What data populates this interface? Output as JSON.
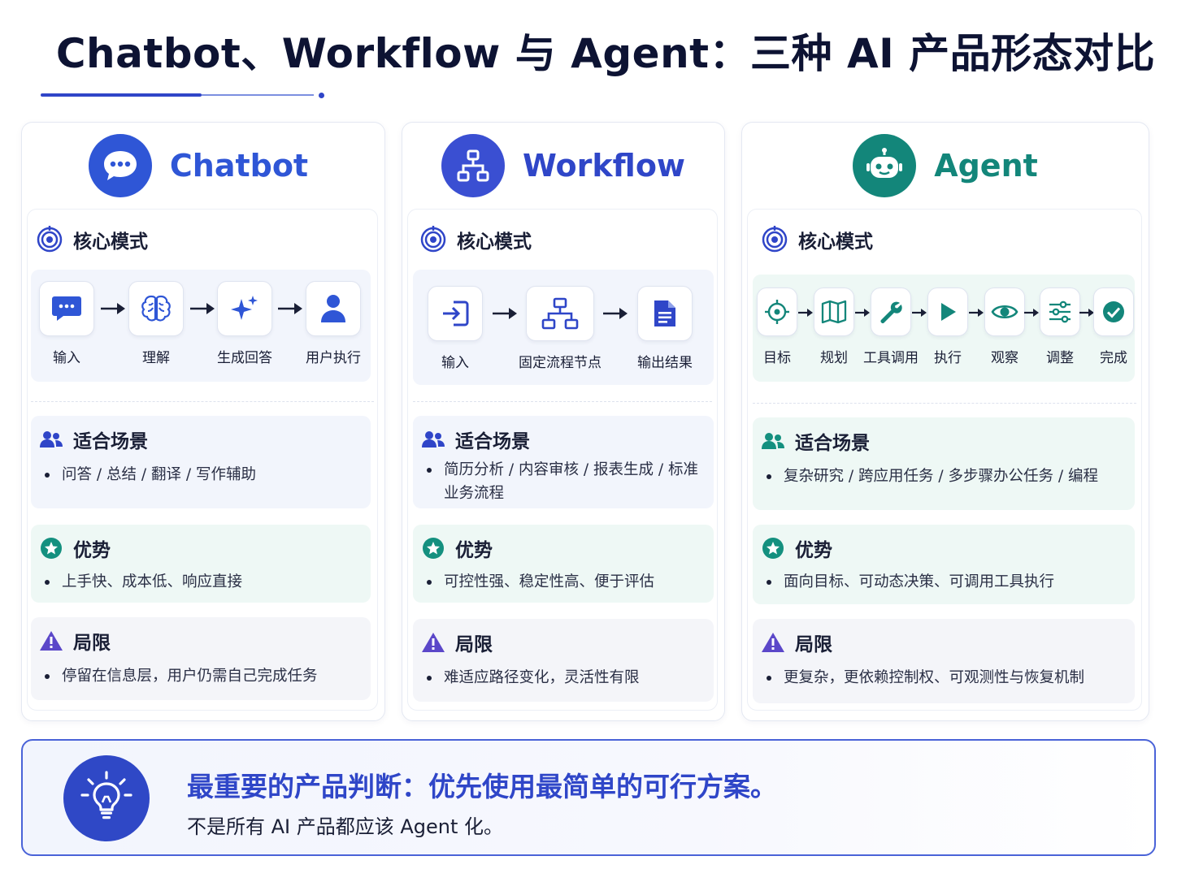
{
  "title": "Chatbot、Workflow 与 Agent：三种 AI 产品形态对比",
  "colors": {
    "primary": "#2f45c8",
    "chatbot": "#2f56d6",
    "workflow": "#3a4fd2",
    "agent": "#13867a",
    "warning": "#5b47c9"
  },
  "columns": [
    {
      "name": "Chatbot",
      "logo_icon": "chat-bubble-icon",
      "core_title": "核心模式",
      "flow": [
        {
          "label": "输入",
          "icon": "chat-icon"
        },
        {
          "label": "理解",
          "icon": "brain-icon"
        },
        {
          "label": "生成回答",
          "icon": "sparkle-icon"
        },
        {
          "label": "用户执行",
          "icon": "user-icon"
        }
      ],
      "scenario_title": "适合场景",
      "scenario_text": "问答 / 总结 / 翻译 / 写作辅助",
      "advantage_title": "优势",
      "advantage_text": "上手快、成本低、响应直接",
      "limit_title": "局限",
      "limit_text": "停留在信息层，用户仍需自己完成任务"
    },
    {
      "name": "Workflow",
      "logo_icon": "workflow-tree-icon",
      "core_title": "核心模式",
      "flow": [
        {
          "label": "输入",
          "icon": "login-icon"
        },
        {
          "label": "固定流程节点",
          "icon": "tree-icon"
        },
        {
          "label": "输出结果",
          "icon": "document-icon"
        }
      ],
      "scenario_title": "适合场景",
      "scenario_text": "简历分析 / 内容审核 / 报表生成 / 标准业务流程",
      "advantage_title": "优势",
      "advantage_text": "可控性强、稳定性高、便于评估",
      "limit_title": "局限",
      "limit_text": "难适应路径变化，灵活性有限"
    },
    {
      "name": "Agent",
      "logo_icon": "robot-icon",
      "core_title": "核心模式",
      "flow": [
        {
          "label": "目标",
          "icon": "target-icon"
        },
        {
          "label": "规划",
          "icon": "map-icon"
        },
        {
          "label": "工具调用",
          "icon": "wrench-icon"
        },
        {
          "label": "执行",
          "icon": "play-icon"
        },
        {
          "label": "观察",
          "icon": "eye-icon"
        },
        {
          "label": "调整",
          "icon": "sliders-icon"
        },
        {
          "label": "完成",
          "icon": "check-icon"
        }
      ],
      "scenario_title": "适合场景",
      "scenario_text": "复杂研究 / 跨应用任务 / 多步骤办公任务 / 编程",
      "advantage_title": "优势",
      "advantage_text": "面向目标、可动态决策、可调用工具执行",
      "limit_title": "局限",
      "limit_text": "更复杂，更依赖控制权、可观测性与恢复机制"
    }
  ],
  "banner": {
    "title": "最重要的产品判断：优先使用最简单的可行方案。",
    "subtitle": "不是所有 AI 产品都应该 Agent 化。",
    "icon": "lightbulb-icon"
  }
}
